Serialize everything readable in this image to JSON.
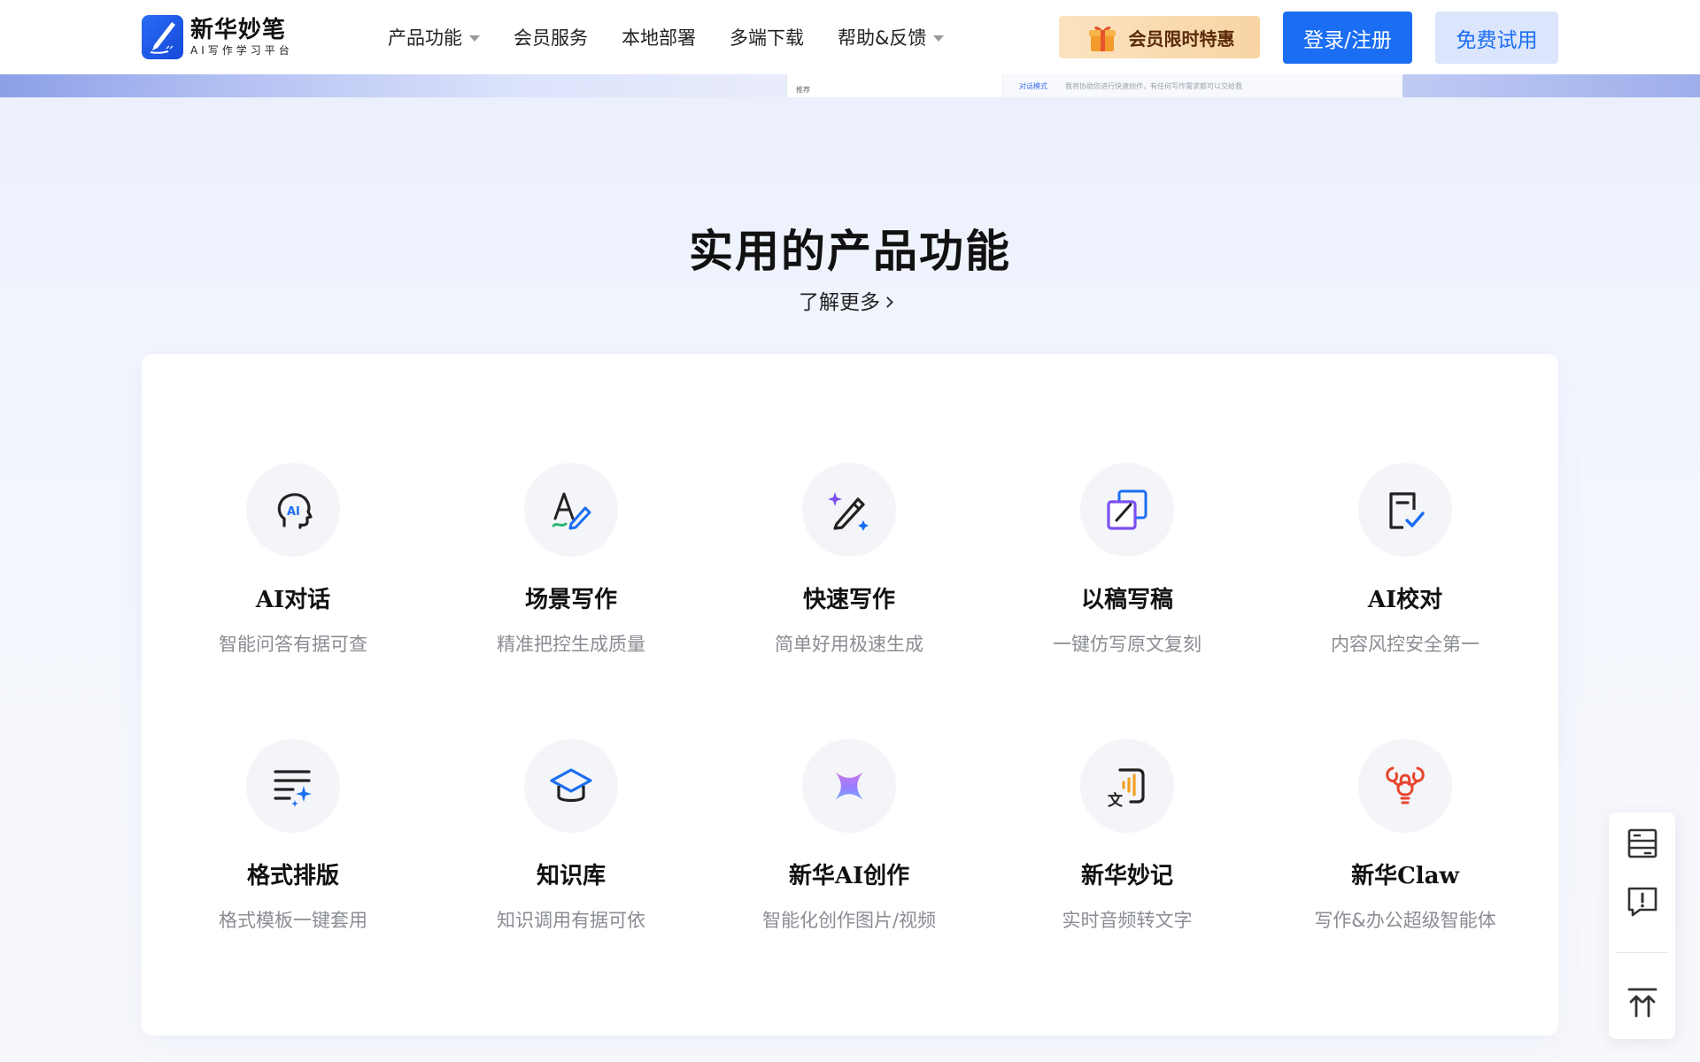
{
  "header": {
    "logo_title": "新华妙笔",
    "logo_subtitle": "AI写作学习平台",
    "nav": [
      {
        "label": "产品功能",
        "has_dropdown": true
      },
      {
        "label": "会员服务",
        "has_dropdown": false
      },
      {
        "label": "本地部署",
        "has_dropdown": false
      },
      {
        "label": "多端下载",
        "has_dropdown": false
      },
      {
        "label": "帮助&反馈",
        "has_dropdown": true
      }
    ],
    "promo_label": "会员限时特惠",
    "login_label": "登录/注册",
    "trial_label": "免费试用"
  },
  "banner": {
    "side_text": "推荐",
    "mode_text": "对话模式",
    "hint_text": "我将协助您进行快速创作，有任何写作需求都可以交给我"
  },
  "section": {
    "title": "实用的产品功能",
    "learn_more": "了解更多"
  },
  "features": [
    {
      "name": "AI对话",
      "desc": "智能问答有据可查",
      "icon": "ai-chat-head-icon"
    },
    {
      "name": "场景写作",
      "desc": "精准把控生成质量",
      "icon": "scene-writing-icon"
    },
    {
      "name": "快速写作",
      "desc": "简单好用极速生成",
      "icon": "magic-pen-icon"
    },
    {
      "name": "以稿写稿",
      "desc": "一键仿写原文复刻",
      "icon": "copy-edit-icon"
    },
    {
      "name": "AI校对",
      "desc": "内容风控安全第一",
      "icon": "proofread-icon"
    },
    {
      "name": "格式排版",
      "desc": "格式模板一键套用",
      "icon": "format-layout-icon"
    },
    {
      "name": "知识库",
      "desc": "知识调用有据可依",
      "icon": "graduation-cap-icon"
    },
    {
      "name": "新华AI创作",
      "desc": "智能化创作图片/视频",
      "icon": "sparkle-star-icon"
    },
    {
      "name": "新华妙记",
      "desc": "实时音频转文字",
      "icon": "audio-transcribe-icon"
    },
    {
      "name": "新华Claw",
      "desc": "写作&办公超级智能体",
      "icon": "lobster-claw-icon"
    }
  ],
  "colors": {
    "brand_blue": "#1b6ef3",
    "trial_bg": "#dbe6fc",
    "promo_bg": "#f8d4a4",
    "claw_red": "#e8452e",
    "purple": "#7b4ff0"
  }
}
